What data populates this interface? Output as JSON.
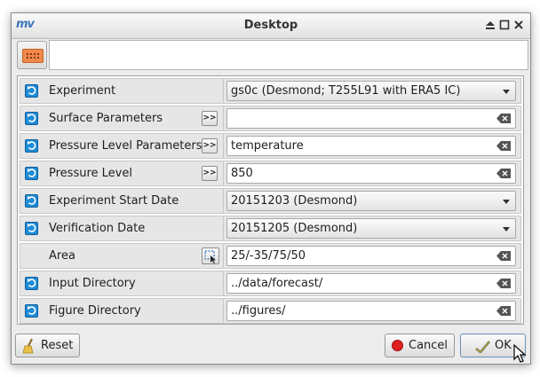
{
  "window": {
    "title": "Desktop",
    "app_logo": "mv"
  },
  "toolbar": {
    "icon": "grid-points-icon",
    "field_value": ""
  },
  "rows": [
    {
      "label": "Experiment",
      "value": "gs0c (Desmond; T255L91 with ERA5 IC)",
      "kind": "combo"
    },
    {
      "label": "Surface Parameters",
      "value": "",
      "kind": "text",
      "helper": ">>"
    },
    {
      "label": "Pressure Level Parameters",
      "value": "temperature",
      "kind": "text",
      "helper": ">>"
    },
    {
      "label": "Pressure Level",
      "value": "850",
      "kind": "text",
      "helper": ">>"
    },
    {
      "label": "Experiment Start Date",
      "value": "20151203 (Desmond)",
      "kind": "combo"
    },
    {
      "label": "Verification Date",
      "value": "20151205 (Desmond)",
      "kind": "combo"
    },
    {
      "label": "Area",
      "value": "25/-35/75/50",
      "kind": "text",
      "helper": "area-select"
    },
    {
      "label": "Input Directory",
      "value": "../data/forecast/",
      "kind": "text"
    },
    {
      "label": "Figure Directory",
      "value": "../figures/",
      "kind": "text"
    }
  ],
  "buttons": {
    "reset": "Reset",
    "cancel": "Cancel",
    "ok": "OK"
  },
  "colors": {
    "reset_icon": "#1f8cd6",
    "cancel_icon": "#e02020",
    "tool_icon": "#f08a4b"
  }
}
